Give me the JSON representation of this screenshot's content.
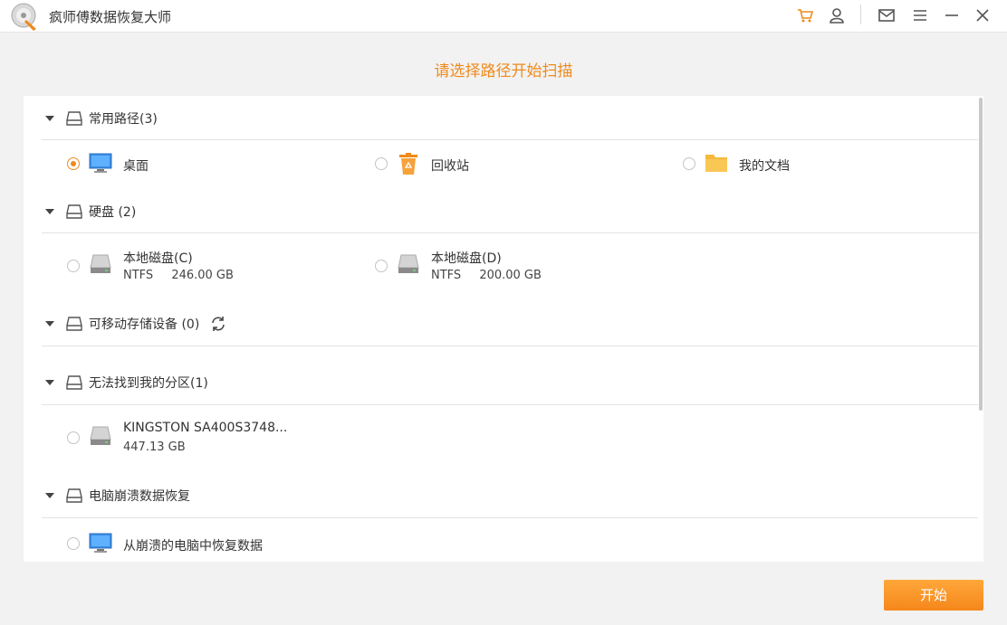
{
  "app": {
    "title": "疯师傅数据恢复大师"
  },
  "heading": "请选择路径开始扫描",
  "sections": {
    "common": {
      "label": "常用路径(3)"
    },
    "disk": {
      "label": "硬盘 (2)"
    },
    "removable": {
      "label": "可移动存储设备 (0)"
    },
    "lost": {
      "label": "无法找到我的分区(1)"
    },
    "crash": {
      "label": "电脑崩溃数据恢复"
    }
  },
  "common_items": {
    "desktop": "桌面",
    "recycle": "回收站",
    "documents": "我的文档"
  },
  "disks": {
    "c": {
      "name": "本地磁盘(C)",
      "fs": "NTFS",
      "size": "246.00 GB"
    },
    "d": {
      "name": "本地磁盘(D)",
      "fs": "NTFS",
      "size": "200.00 GB"
    }
  },
  "lost_disk": {
    "name": "KINGSTON SA400S3748...",
    "size": "447.13 GB"
  },
  "crash_item": "从崩溃的电脑中恢复数据",
  "buttons": {
    "start": "开始"
  },
  "colors": {
    "accent": "#f08a1c",
    "button": "#f5871b"
  },
  "icons": [
    "cart-icon",
    "user-icon",
    "mail-icon",
    "menu-icon",
    "minimize-icon",
    "close-icon",
    "refresh-icon",
    "monitor-icon",
    "recycle-bin-icon",
    "folder-icon",
    "hard-drive-icon"
  ]
}
